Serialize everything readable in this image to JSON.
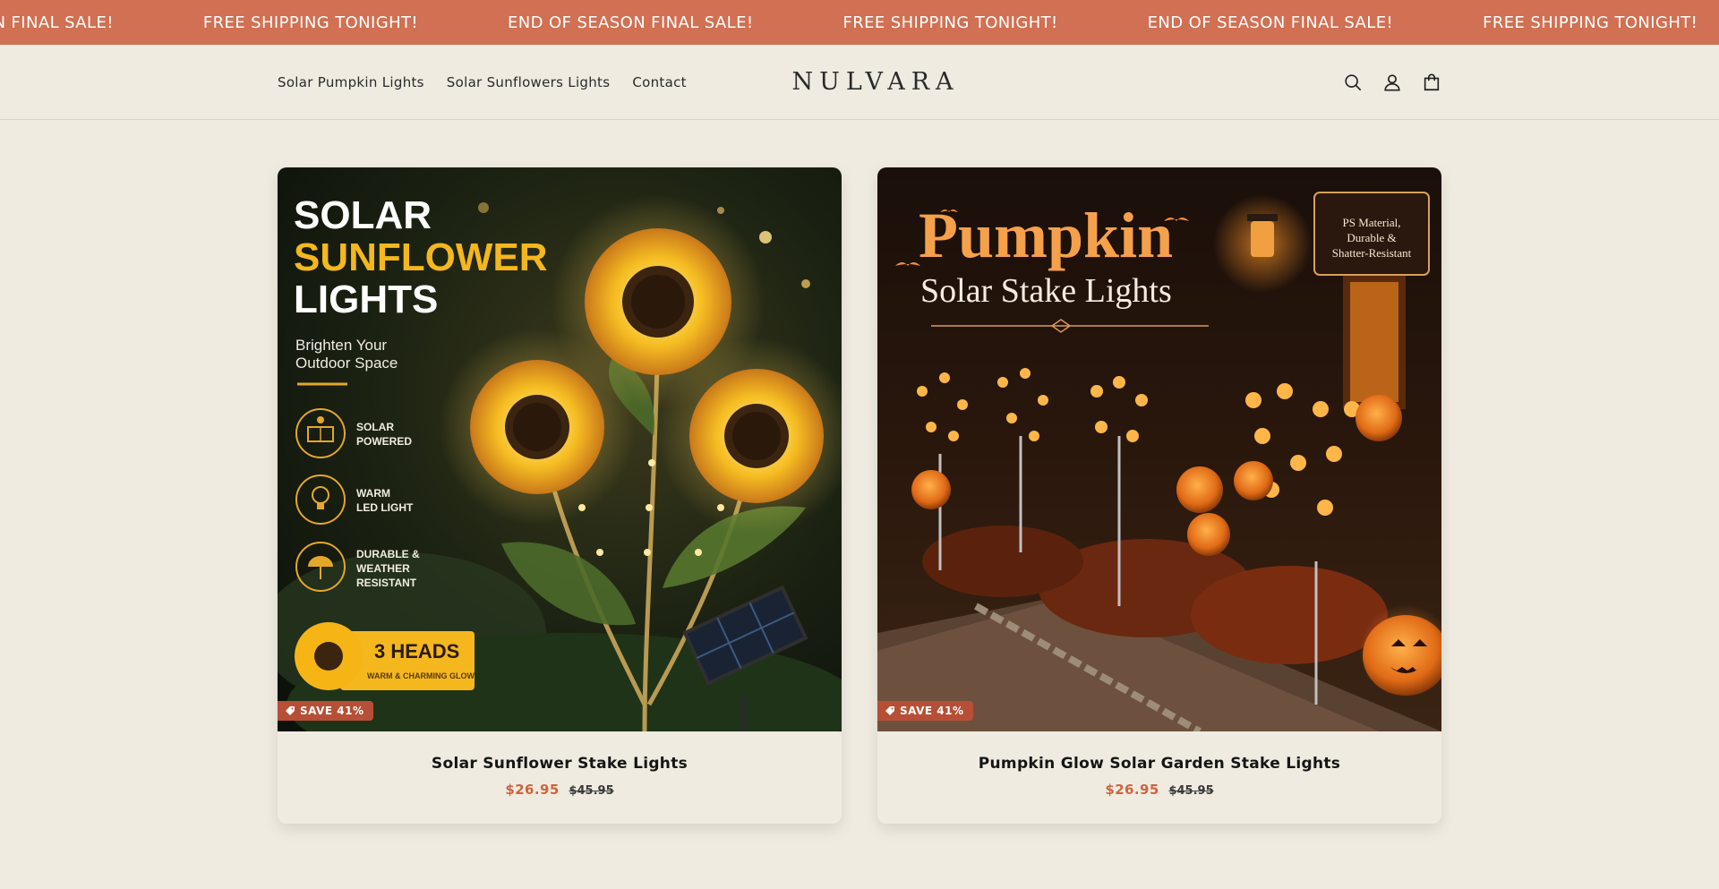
{
  "announcement": {
    "items": [
      "ON FINAL SALE!",
      "FREE SHIPPING TONIGHT!",
      "END OF SEASON FINAL SALE!",
      "FREE SHIPPING TONIGHT!",
      "END OF SEASON FINAL SALE!",
      "FREE SHIPPING TONIGHT!"
    ],
    "bg": "#d17052"
  },
  "header": {
    "nav": [
      "Solar Pumpkin Lights",
      "Solar Sunflowers Lights",
      "Contact"
    ],
    "logo": "NULVARA",
    "icons": [
      "search-icon",
      "account-icon",
      "cart-icon"
    ]
  },
  "products": [
    {
      "title": "Solar Sunflower Stake Lights",
      "price": "$26.95",
      "compare_price": "$45.95",
      "badge": "SAVE 41%",
      "image": {
        "heading_1": "SOLAR",
        "heading_2": "SUNFLOWER",
        "heading_3": "LIGHTS",
        "subtitle_1": "Brighten Your",
        "subtitle_2": "Outdoor Space",
        "features": [
          {
            "line1": "SOLAR",
            "line2": "POWERED",
            "line3": ""
          },
          {
            "line1": "WARM",
            "line2": "LED LIGHT",
            "line3": ""
          },
          {
            "line1": "DURABLE &",
            "line2": "WEATHER",
            "line3": "RESISTANT"
          }
        ],
        "heads_label": "3 HEADS",
        "heads_sub": "WARM & CHARMING GLOW"
      }
    },
    {
      "title": "Pumpkin Glow Solar Garden Stake Lights",
      "price": "$26.95",
      "compare_price": "$45.95",
      "badge": "SAVE 41%",
      "image": {
        "heading_1": "Pumpkin",
        "heading_2": "Solar Stake Lights",
        "seal_1": "PS Material,",
        "seal_2": "Durable &",
        "seal_3": "Shatter-Resistant"
      }
    }
  ],
  "colors": {
    "page_bg": "#efebe0",
    "accent": "#d0643f",
    "badge": "#b64f36"
  }
}
